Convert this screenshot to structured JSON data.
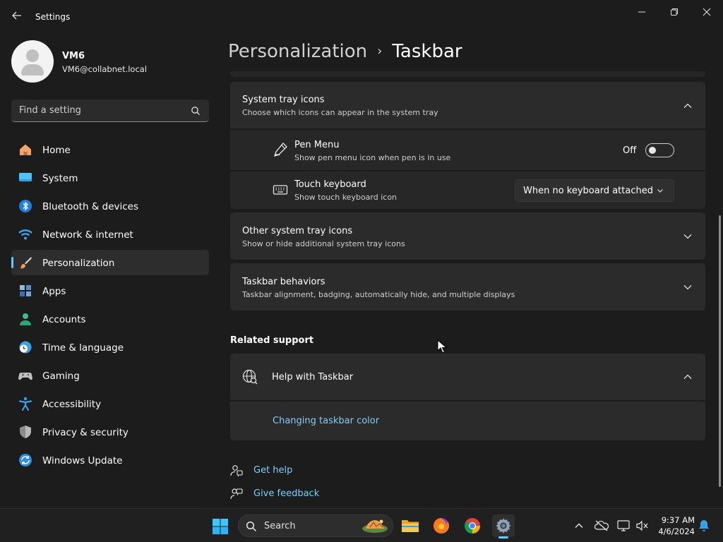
{
  "window": {
    "title": "Settings",
    "back_icon": "back-arrow-icon",
    "controls": [
      "minimize-icon",
      "restore-icon",
      "close-icon"
    ]
  },
  "user": {
    "name": "VM6",
    "email": "VM6@collabnet.local"
  },
  "search": {
    "placeholder": "Find a setting"
  },
  "sidebar": {
    "items": [
      {
        "label": "Home",
        "icon": "home-icon",
        "active": false
      },
      {
        "label": "System",
        "icon": "system-icon",
        "active": false
      },
      {
        "label": "Bluetooth & devices",
        "icon": "bluetooth-icon",
        "active": false
      },
      {
        "label": "Network & internet",
        "icon": "wifi-icon",
        "active": false
      },
      {
        "label": "Personalization",
        "icon": "brush-icon",
        "active": true
      },
      {
        "label": "Apps",
        "icon": "apps-icon",
        "active": false
      },
      {
        "label": "Accounts",
        "icon": "accounts-icon",
        "active": false
      },
      {
        "label": "Time & language",
        "icon": "clock-globe-icon",
        "active": false
      },
      {
        "label": "Gaming",
        "icon": "gamepad-icon",
        "active": false
      },
      {
        "label": "Accessibility",
        "icon": "accessibility-icon",
        "active": false
      },
      {
        "label": "Privacy & security",
        "icon": "shield-icon",
        "active": false
      },
      {
        "label": "Windows Update",
        "icon": "update-icon",
        "active": false
      }
    ]
  },
  "breadcrumb": {
    "parent": "Personalization",
    "separator": "›",
    "current": "Taskbar"
  },
  "system_tray": {
    "title": "System tray icons",
    "subtitle": "Choose which icons can appear in the system tray",
    "expanded": true,
    "items": {
      "pen_menu": {
        "title": "Pen Menu",
        "subtitle": "Show pen menu icon when pen is in use",
        "state_label": "Off",
        "on": false
      },
      "touch_keyboard": {
        "title": "Touch keyboard",
        "subtitle": "Show touch keyboard icon",
        "selected": "When no keyboard attached"
      }
    }
  },
  "other_tray": {
    "title": "Other system tray icons",
    "subtitle": "Show or hide additional system tray icons",
    "expanded": false
  },
  "behaviors": {
    "title": "Taskbar behaviors",
    "subtitle": "Taskbar alignment, badging, automatically hide, and multiple displays",
    "expanded": false
  },
  "related_support": {
    "heading": "Related support",
    "help_title": "Help with Taskbar",
    "expanded": true,
    "link": "Changing taskbar color"
  },
  "footer_links": {
    "get_help": "Get help",
    "give_feedback": "Give feedback"
  },
  "taskbar": {
    "search_label": "Search",
    "apps": [
      "file-explorer-icon",
      "firefox-icon",
      "chrome-icon",
      "settings-icon"
    ],
    "clock": {
      "time": "9:37 AM",
      "date": "4/6/2024"
    }
  },
  "colors": {
    "accent": "#60cdff",
    "link": "#7ccffa",
    "background": "#1c1c1c",
    "card": "#2b2b2b"
  }
}
